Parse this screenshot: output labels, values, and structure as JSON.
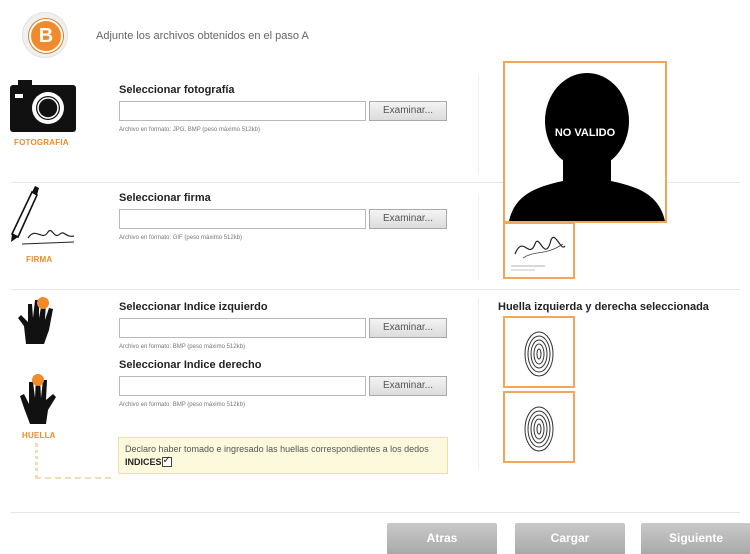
{
  "step": {
    "badge": "B",
    "instruction": "Adjunte los archivos obtenidos en el paso A"
  },
  "sections": {
    "foto": {
      "label": "FOTOGRAFIA",
      "title": "Seleccionar fotografía",
      "button": "Examinar...",
      "hint": "Archivo en formato: JPG, BMP (peso máximo 512kb)"
    },
    "firma": {
      "label": "FIRMA",
      "title": "Seleccionar firma",
      "button": "Examinar...",
      "hint": "Archivo en formato: GIF (peso máximo 512kb)"
    },
    "huella": {
      "label": "HUELLA",
      "left_title": "Seleccionar Indice izquierdo",
      "left_button": "Examinar...",
      "left_hint": "Archivo en formato: BMP (peso máximo 512kb)",
      "right_title": "Seleccionar Indice derecho",
      "right_button": "Examinar...",
      "right_hint": "Archivo en formato: BMP (peso máximo 512kb)"
    }
  },
  "preview": {
    "photo_overlay": "NO VALIDO",
    "huella_title": "Huella izquierda y derecha seleccionada"
  },
  "declaration": {
    "text": "Declaro haber tomado e ingresado las huellas correspondientes a los dedos",
    "bold": "INDICES",
    "checked": true
  },
  "nav": {
    "back": "Atras",
    "upload": "Cargar",
    "next": "Siguiente"
  },
  "colors": {
    "accent": "#f08a2a",
    "frame": "#f3a55a",
    "button": "#b4b4b4"
  }
}
